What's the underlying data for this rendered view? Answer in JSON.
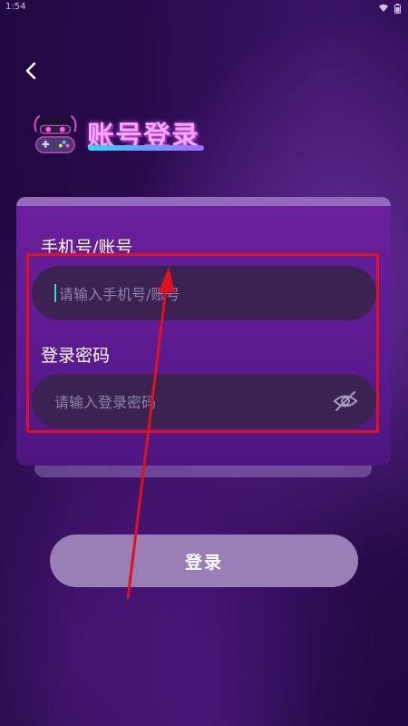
{
  "status_bar": {
    "time": "1:54"
  },
  "page": {
    "title": "账号登录"
  },
  "form": {
    "phone_label": "手机号/账号",
    "phone_placeholder": "请输入手机号/账号",
    "password_label": "登录密码",
    "password_placeholder": "请输入登录密码"
  },
  "actions": {
    "login_label": "登录"
  },
  "colors": {
    "accent": "#f4a9ff",
    "highlight_box": "#e2101a",
    "card": "#5b1a90",
    "input_bg": "#3b2252",
    "button": "#9a7fb6"
  }
}
